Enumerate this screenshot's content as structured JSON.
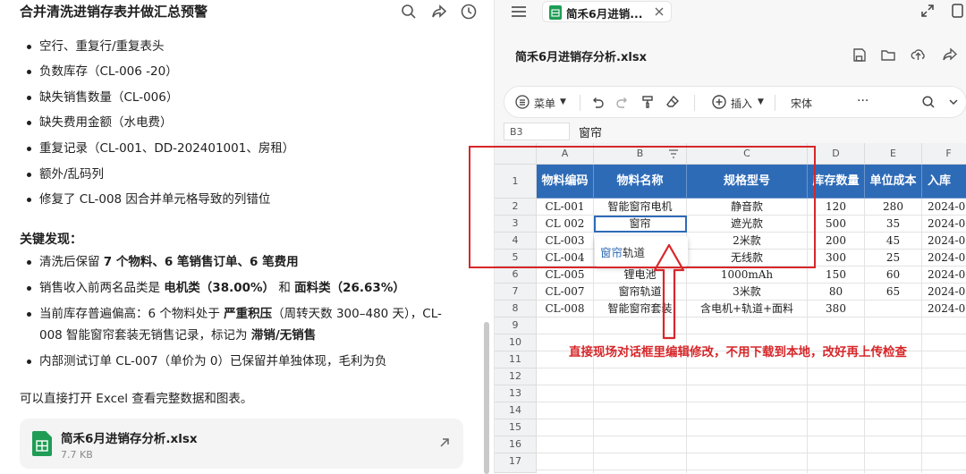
{
  "chat": {
    "title": "合并清洗进销存表并做汇总预警",
    "bullets_top": [
      "空行、重复行/重复表头",
      "负数库存（CL-006 -20）",
      "缺失销售数量（CL-006）",
      "缺失费用金额（水电费）",
      "重复记录（CL-001、DD-202401001、房租）",
      "额外/乱码列",
      "修复了 CL-008 因合并单元格导致的列错位"
    ],
    "key_findings_title": "关键发现：",
    "findings": {
      "f1_pre": "清洗后保留 ",
      "f1_bold": "7 个物料、6 笔销售订单、6 笔费用",
      "f2_pre": "销售收入前两名品类是 ",
      "f2_b1": "电机类（38.00%）",
      "f2_mid": " 和 ",
      "f2_b2": "面料类（26.63%）",
      "f3_pre": "当前库存普遍偏高：6 个物料处于 ",
      "f3_b1": "严重积压",
      "f3_mid": "（周转天数 300–480 天），CL-",
      "f3_l2": "008 智能窗帘套装无销售记录，标记为 ",
      "f3_b2": "滞销/无销售",
      "f4": "内部测试订单 CL-007（单价为 0）已保留并单独体现，毛利为负"
    },
    "closing": "可以直接打开 Excel 查看完整数据和图表。",
    "file": {
      "name": "简禾6月进销存分析.xlsx",
      "size": "7.7 KB"
    }
  },
  "sheet": {
    "tab_label": "简禾6月进销...",
    "doc_title": "简禾6月进销存分析.xlsx",
    "toolbar": {
      "menu": "菜单",
      "insert": "插入",
      "font": "宋体"
    },
    "name_box": "B3",
    "formula": "窗帘",
    "col_letters": [
      "A",
      "B",
      "C",
      "D",
      "E",
      "F"
    ],
    "row_numbers": [
      "1",
      "2",
      "3",
      "4",
      "5",
      "6",
      "7",
      "8",
      "9",
      "10",
      "11",
      "12",
      "13",
      "14",
      "15",
      "16",
      "17"
    ],
    "headers": [
      "物料编码",
      "物料名称",
      "规格型号",
      "库存数量",
      "单位成本",
      "入库"
    ],
    "rows": [
      [
        "CL-001",
        "智能窗帘电机",
        "静音款",
        "120",
        "280",
        "2024-0"
      ],
      [
        "CL 002",
        "窗帘",
        "遮光款",
        "500",
        "35",
        "2024-0"
      ],
      [
        "CL-003",
        "",
        "2米款",
        "200",
        "45",
        "2024-0"
      ],
      [
        "CL-004",
        "",
        "无线款",
        "300",
        "25",
        "2024-0"
      ],
      [
        "CL-005",
        "锂电池",
        "1000mAh",
        "150",
        "60",
        "2024-0"
      ],
      [
        "CL-007",
        "窗帘轨道",
        "3米款",
        "80",
        "65",
        "2024-0"
      ],
      [
        "CL-008",
        "智能窗帘套装",
        "含电机+轨道+面料",
        "380",
        "",
        "2024-0"
      ]
    ],
    "dropdown": {
      "highlight": "窗帘",
      "rest": "轨道"
    }
  },
  "annotation": {
    "text": "直接现场对话框里编辑修改，不用下载到本地，改好再上传检查",
    "color": "#d7272a"
  },
  "colors": {
    "header_fill": "#2e6bb7",
    "accent": "#2e6bb7",
    "annotation": "#d7272a",
    "file_green": "#1f9d55"
  }
}
